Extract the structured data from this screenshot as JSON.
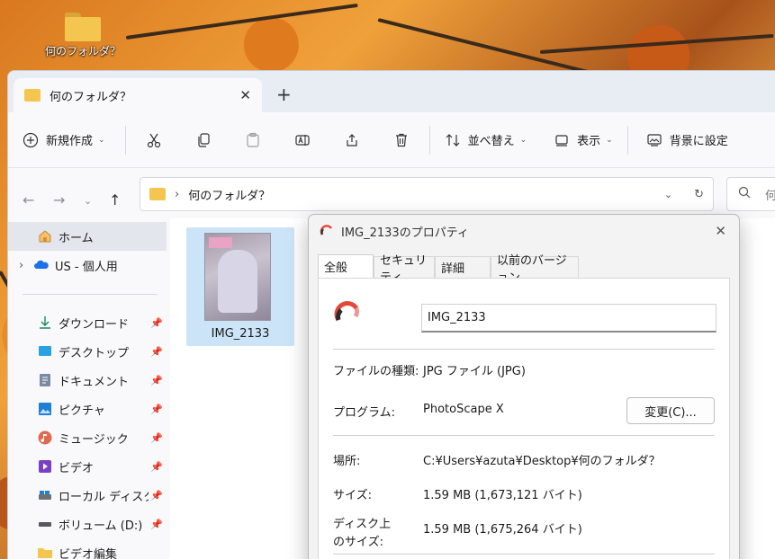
{
  "desktop": {
    "folder_label": "何のフォルダ？"
  },
  "explorer": {
    "tab_title": "何のフォルダ？",
    "toolbar": {
      "new_label": "新規作成",
      "sort_label": "並べ替え",
      "view_label": "表示",
      "set_background_label": "背景に設定"
    },
    "address": {
      "path_label": "何のフォルダ？",
      "search_placeholder": "何"
    },
    "sidebar": {
      "items": [
        {
          "label": "ホーム",
          "icon": "home-icon"
        },
        {
          "label": "US - 個人用",
          "icon": "onedrive-icon"
        },
        {
          "label": "ダウンロード",
          "icon": "download-icon"
        },
        {
          "label": "デスクトップ",
          "icon": "desktop-icon"
        },
        {
          "label": "ドキュメント",
          "icon": "document-icon"
        },
        {
          "label": "ピクチャ",
          "icon": "pictures-icon"
        },
        {
          "label": "ミュージック",
          "icon": "music-icon"
        },
        {
          "label": "ビデオ",
          "icon": "video-icon"
        },
        {
          "label": "ローカル ディスク (C:)",
          "icon": "drive-icon"
        },
        {
          "label": "ボリューム (D:)",
          "icon": "drive-icon"
        },
        {
          "label": "ビデオ編集",
          "icon": "folder-icon"
        }
      ]
    },
    "files": [
      {
        "name": "IMG_2133"
      }
    ]
  },
  "properties": {
    "title": "IMG_2133のプロパティ",
    "tabs": [
      "全般",
      "セキュリティ",
      "詳細",
      "以前のバージョン"
    ],
    "file_name": "IMG_2133",
    "file_type_label": "ファイルの種類:",
    "file_type_value": "JPG ファイル (JPG)",
    "program_label": "プログラム:",
    "program_value": "PhotoScape X",
    "change_button": "変更(C)...",
    "location_label": "場所:",
    "location_value": "C:¥Users¥azuta¥Desktop¥何のフォルダ？",
    "size_label": "サイズ:",
    "size_value": "1.59 MB (1,673,121 バイト)",
    "disk_size_label_1": "ディスク上",
    "disk_size_label_2": "のサイズ:",
    "disk_size_value": "1.59 MB (1,675,264 バイト)"
  },
  "colors": {
    "folder": "#f4c64f",
    "accent": "#0067c0",
    "selection": "#cce4f7"
  }
}
